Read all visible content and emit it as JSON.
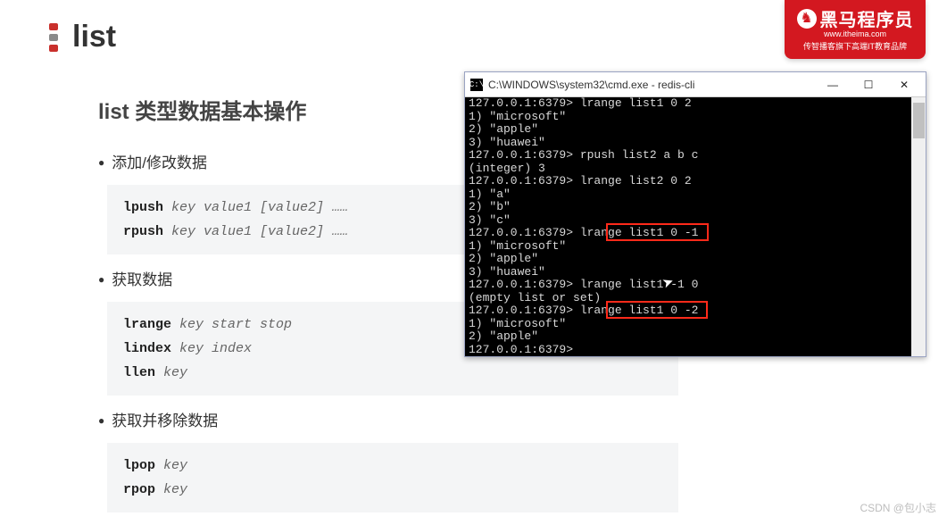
{
  "header": {
    "logo_text": "list"
  },
  "brand": {
    "title": "黑马程序员",
    "sub1": "www.itheima.com",
    "sub2": "传智播客旗下高端IT教育品牌"
  },
  "section": {
    "title": "list 类型数据基本操作",
    "items": [
      {
        "label": "添加/修改数据",
        "code_lines": [
          {
            "cmd": "lpush",
            "args": "key value1 [value2] ……"
          },
          {
            "cmd": "rpush",
            "args": "key value1 [value2] ……"
          }
        ]
      },
      {
        "label": "获取数据",
        "code_lines": [
          {
            "cmd": "lrange",
            "args": "key start stop"
          },
          {
            "cmd": "lindex",
            "args": "key index"
          },
          {
            "cmd": "llen",
            "args": "key"
          }
        ]
      },
      {
        "label": "获取并移除数据",
        "code_lines": [
          {
            "cmd": "lpop",
            "args": "key"
          },
          {
            "cmd": "rpop",
            "args": "key"
          }
        ]
      }
    ]
  },
  "terminal": {
    "title": "C:\\WINDOWS\\system32\\cmd.exe - redis-cli",
    "lines": [
      "127.0.0.1:6379> lrange list1 0 2",
      "1) \"microsoft\"",
      "2) \"apple\"",
      "3) \"huawei\"",
      "127.0.0.1:6379> rpush list2 a b c",
      "(integer) 3",
      "127.0.0.1:6379> lrange list2 0 2",
      "1) \"a\"",
      "2) \"b\"",
      "3) \"c\"",
      "127.0.0.1:6379> lrange list1 0 -1",
      "1) \"microsoft\"",
      "2) \"apple\"",
      "3) \"huawei\"",
      "127.0.0.1:6379> lrange list1 -1 0",
      "(empty list or set)",
      "127.0.0.1:6379> lrange list1 0 -2",
      "1) \"microsoft\"",
      "2) \"apple\"",
      "127.0.0.1:6379>"
    ]
  },
  "watermark": "CSDN @包小志"
}
